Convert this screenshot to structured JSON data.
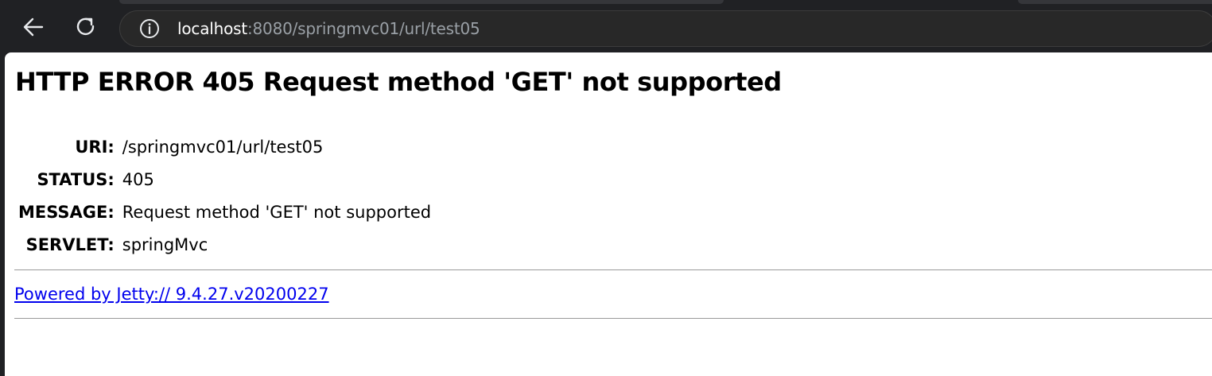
{
  "browser": {
    "url_host": "localhost",
    "url_path": ":8080/springmvc01/url/test05",
    "icons": {
      "back": "back-arrow-icon",
      "reload": "reload-icon",
      "info": "info-icon"
    }
  },
  "page": {
    "heading": "HTTP ERROR 405 Request method 'GET' not supported",
    "rows": [
      {
        "label": "URI:",
        "value": "/springmvc01/url/test05"
      },
      {
        "label": "STATUS:",
        "value": "405"
      },
      {
        "label": "MESSAGE:",
        "value": "Request method 'GET' not supported"
      },
      {
        "label": "SERVLET:",
        "value": "springMvc"
      }
    ],
    "powered_by": "Powered by Jetty:// 9.4.27.v20200227",
    "link_color": "#0000ee"
  }
}
